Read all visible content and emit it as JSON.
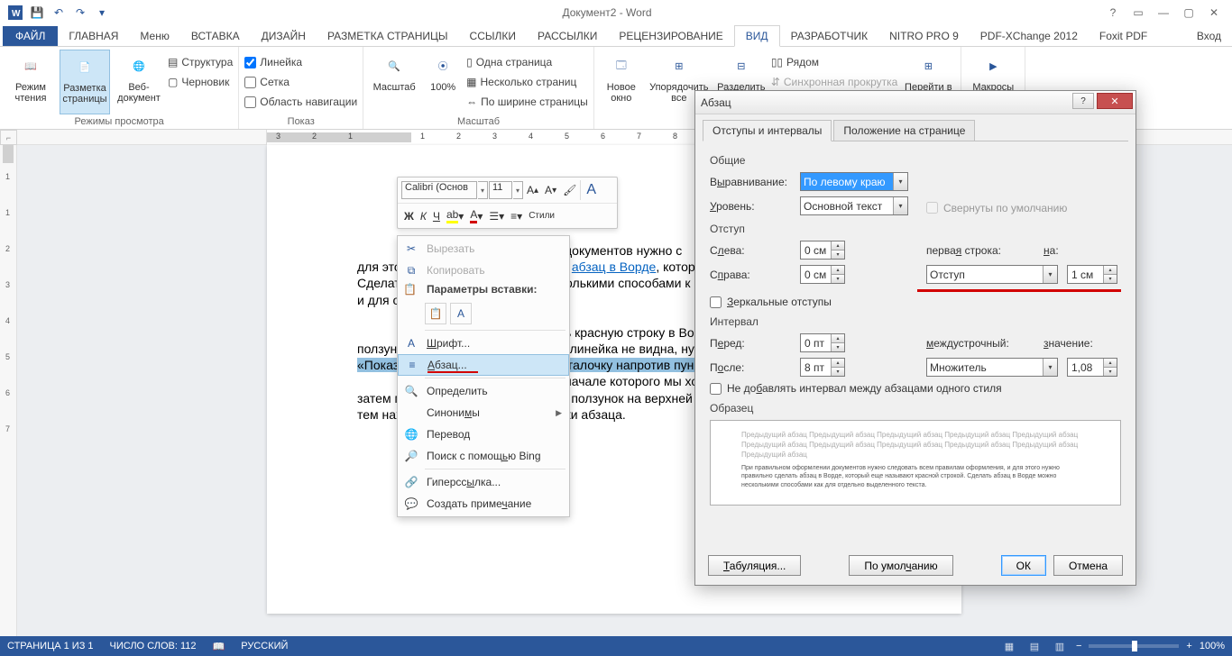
{
  "title": "Документ2 - Word",
  "qat": [
    "word",
    "save",
    "undo",
    "redo",
    "new"
  ],
  "win": {
    "help": "?",
    "ribbon": "▭",
    "min": "—",
    "max": "▢",
    "close": "✕"
  },
  "tabs": {
    "file": "ФАЙЛ",
    "home": "ГЛАВНАЯ",
    "menu": "Меню",
    "insert": "ВСТАВКА",
    "design": "ДИЗАЙН",
    "layout": "РАЗМЕТКА СТРАНИЦЫ",
    "refs": "ССЫЛКИ",
    "mail": "РАССЫЛКИ",
    "review": "РЕЦЕНЗИРОВАНИЕ",
    "view": "ВИД",
    "dev": "РАЗРАБОТЧИК",
    "nitro": "NITRO PRO 9",
    "pdfx": "PDF-XChange 2012",
    "foxit": "Foxit PDF",
    "signin": "Вход"
  },
  "ribbon": {
    "views": {
      "read": "Режим чтения",
      "layout": "Разметка страницы",
      "web": "Веб-документ",
      "outline": "Структура",
      "draft": "Черновик",
      "group": "Режимы просмотра"
    },
    "show": {
      "ruler": "Линейка",
      "grid": "Сетка",
      "nav": "Область навигации",
      "group": "Показ"
    },
    "zoom": {
      "zoom": "Масштаб",
      "hundred": "100%",
      "one": "Одна страница",
      "multi": "Несколько страниц",
      "width": "По ширине страницы",
      "group": "Масштаб"
    },
    "window": {
      "new": "Новое окно",
      "arrange": "Упорядочить все",
      "split": "Разделить",
      "side": "Рядом",
      "sync": "Синхронная прокрутка",
      "goto": "Перейти в"
    },
    "macros": "Макросы"
  },
  "mini": {
    "font": "Calibri (Основ",
    "size": "11",
    "styles": "Стили"
  },
  "ctx": {
    "cut": "Вырезать",
    "copy": "Копировать",
    "pasteopts": "Параметры вставки:",
    "font": "Шрифт...",
    "para": "Абзац...",
    "define": "Определить",
    "syn": "Синонимы",
    "translate": "Перевод",
    "bing": "Поиск с помощью Bing",
    "link": "Гиперссылка...",
    "comment": "Создать примечание"
  },
  "doc": {
    "l1": "документов нужно с",
    "l2": "для этого нужно правильно сделать абзац в Ворде, котор",
    "l3": "Сделать абзац в Ворде можно несколькими способами к",
    "l4": "и для отдельно выделенного текста.",
    "l5": "ь красную строку в Во",
    "l6": "ползунки на верхней линейке. Если линейка не видна, ну",
    "l7": "«Показ» закладки «Вид» поставить галочку напротив пункта «Линейка».",
    "l8": "начале которого мы хотим сместить или",
    "l9": "затем перетягиваем левый верхний ползунок на верхней",
    "l10": "тем находим «Отступ» первой строки абзаца."
  },
  "dialog": {
    "title": "Абзац",
    "tab1": "Отступы и интервалы",
    "tab2": "Положение на странице",
    "general": "Общие",
    "align_l": "Выравнивание:",
    "align_v": "По левому краю",
    "level_l": "Уровень:",
    "level_v": "Основной текст",
    "collapse": "Свернуты по умолчанию",
    "indent": "Отступ",
    "left_l": "Слева:",
    "left_v": "0 см",
    "right_l": "Справа:",
    "right_v": "0 см",
    "first_l": "первая строка:",
    "first_v": "Отступ",
    "by_l": "на:",
    "by_v": "1 см",
    "mirror": "Зеркальные отступы",
    "spacing": "Интервал",
    "before_l": "Перед:",
    "before_v": "0 пт",
    "after_l": "После:",
    "after_v": "8 пт",
    "line_l": "междустрочный:",
    "line_v": "Множитель",
    "val_l": "значение:",
    "val_v": "1,08",
    "nosame": "Не добавлять интервал между абзацами одного стиля",
    "preview": "Образец",
    "prev_text": "Предыдущий абзац Предыдущий абзац Предыдущий абзац Предыдущий абзац Предыдущий абзац Предыдущий абзац Предыдущий абзац Предыдущий абзац Предыдущий абзац Предыдущий абзац Предыдущий абзац",
    "prev_text2": "При правильном оформлении документов нужно следовать всем правилам оформления, и для этого нужно правильно сделать абзац в Ворде, который еще называют красной строкой. Сделать абзац в Ворде можно несколькими способами как для отдельно выделенного текста.",
    "tabs_btn": "Табуляция...",
    "default_btn": "По умолчанию",
    "ok": "ОК",
    "cancel": "Отмена"
  },
  "status": {
    "page": "СТРАНИЦА 1 ИЗ 1",
    "words": "ЧИСЛО СЛОВ: 112",
    "lang": "РУССКИЙ",
    "zoom": "100%"
  }
}
